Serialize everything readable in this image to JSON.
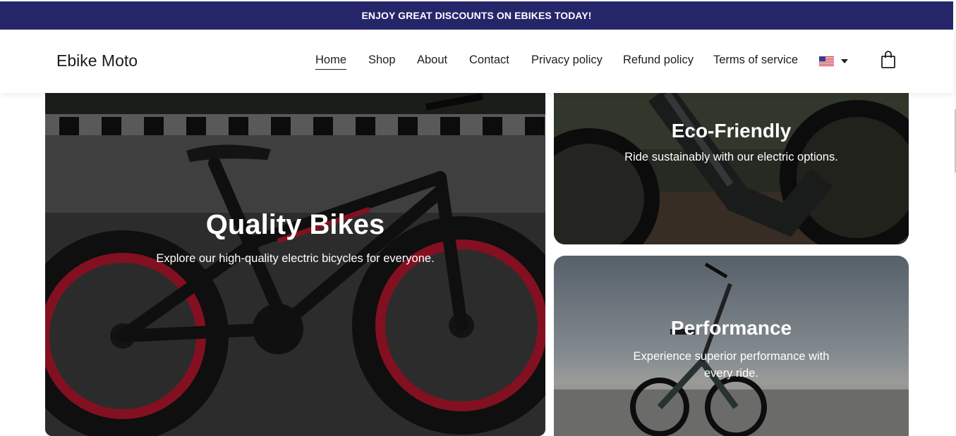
{
  "announcement": {
    "text": "ENJOY GREAT DISCOUNTS ON EBIKES TODAY!"
  },
  "header": {
    "logo": "Ebike Moto",
    "nav": [
      "Home",
      "Shop",
      "About",
      "Contact",
      "Privacy policy",
      "Refund policy",
      "Terms of service"
    ],
    "active_nav": "Home",
    "language_flag_icon": "us-flag-icon",
    "cart_icon": "shopping-bag-icon"
  },
  "tiles": {
    "quality": {
      "title": "Quality Bikes",
      "text": "Explore our high-quality electric bicycles for everyone."
    },
    "eco": {
      "title": "Eco-Friendly",
      "text": "Ride sustainably with our electric options."
    },
    "performance": {
      "title": "Performance",
      "text": "Experience superior performance with every ride."
    }
  },
  "colors": {
    "announcement_bg": "#25266a",
    "accent_rim": "#e21c3a"
  }
}
